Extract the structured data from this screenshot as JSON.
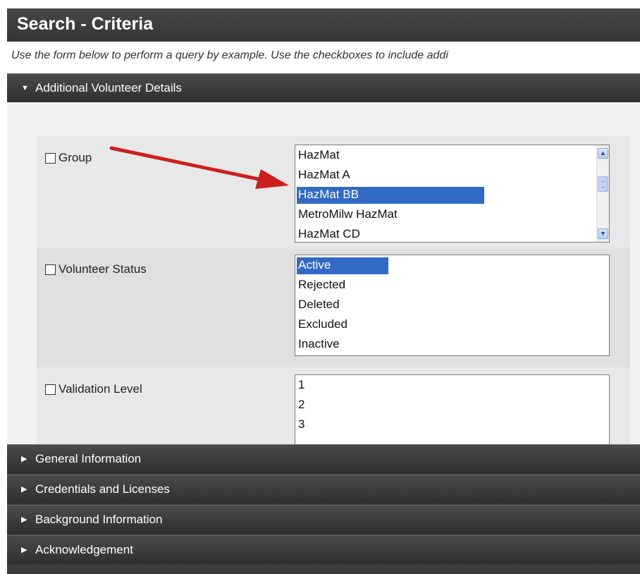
{
  "title": "Search - Criteria",
  "description": "Use the form below to perform a query by example. Use the checkboxes to include addi",
  "sections": {
    "expanded": {
      "label": "Additional Volunteer Details",
      "arrow_icon": "triangle-down-icon"
    },
    "collapsed": [
      {
        "label": "General Information",
        "arrow_icon": "triangle-right-icon"
      },
      {
        "label": "Credentials and Licenses",
        "arrow_icon": "triangle-right-icon"
      },
      {
        "label": "Background Information",
        "arrow_icon": "triangle-right-icon"
      },
      {
        "label": "Acknowledgement",
        "arrow_icon": "triangle-right-icon"
      }
    ]
  },
  "fields": {
    "group": {
      "label": "Group",
      "checked": false,
      "options": [
        "HazMat",
        "HazMat A",
        "HazMat BB",
        "MetroMilw HazMat",
        "HazMat CD"
      ],
      "selected": "HazMat BB"
    },
    "volunteer_status": {
      "label": "Volunteer Status",
      "checked": false,
      "options": [
        "Active",
        "Rejected",
        "Deleted",
        "Excluded",
        "Inactive"
      ],
      "selected": "Active"
    },
    "validation_level": {
      "label": "Validation Level",
      "checked": false,
      "options": [
        "1",
        "2",
        "3"
      ]
    }
  },
  "annotation": {
    "arrow_color": "#cc1f1f"
  },
  "colors": {
    "header_bg": "#3c3c3c",
    "selection": "#316ac5"
  }
}
